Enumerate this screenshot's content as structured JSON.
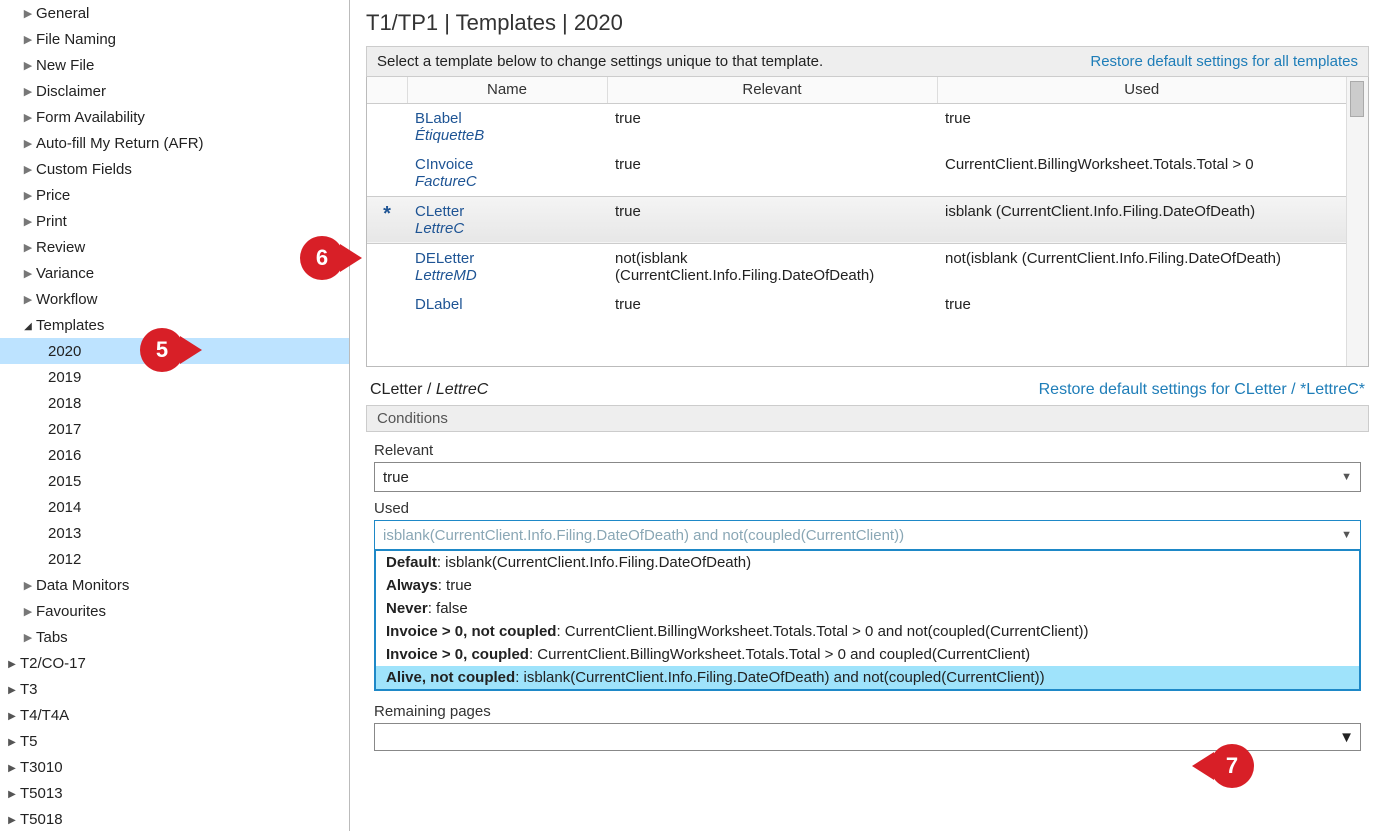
{
  "sidebar": {
    "items": [
      {
        "label": "General",
        "expandable": true
      },
      {
        "label": "File Naming",
        "expandable": true
      },
      {
        "label": "New File",
        "expandable": true
      },
      {
        "label": "Disclaimer",
        "expandable": true
      },
      {
        "label": "Form Availability",
        "expandable": true
      },
      {
        "label": "Auto-fill My Return (AFR)",
        "expandable": true
      },
      {
        "label": "Custom Fields",
        "expandable": true
      },
      {
        "label": "Price",
        "expandable": true
      },
      {
        "label": "Print",
        "expandable": true
      },
      {
        "label": "Review",
        "expandable": true
      },
      {
        "label": "Variance",
        "expandable": true
      },
      {
        "label": "Workflow",
        "expandable": true
      }
    ],
    "templates_label": "Templates",
    "years": [
      "2020",
      "2019",
      "2018",
      "2017",
      "2016",
      "2015",
      "2014",
      "2013",
      "2012"
    ],
    "selected_year": "2020",
    "items_after": [
      {
        "label": "Data Monitors",
        "expandable": true
      },
      {
        "label": "Favourites",
        "expandable": true
      },
      {
        "label": "Tabs",
        "expandable": true
      }
    ],
    "bottom": [
      "T2/CO-17",
      "T3",
      "T4/T4A",
      "T5",
      "T3010",
      "T5013",
      "T5018"
    ]
  },
  "breadcrumb": "T1/TP1 | Templates | 2020",
  "instruction": "Select a template below to change settings unique to that template.",
  "restore_all_link": "Restore default settings for all templates",
  "columns": {
    "name": "Name",
    "relevant": "Relevant",
    "used": "Used"
  },
  "rows": [
    {
      "flag": "",
      "name": "BLabel",
      "sub": "ÉtiquetteB",
      "relevant": "true",
      "used": "true"
    },
    {
      "flag": "",
      "name": "CInvoice",
      "sub": "FactureC",
      "relevant": "true",
      "used": "CurrentClient.BillingWorksheet.Totals.Total > 0"
    },
    {
      "flag": "*",
      "name": "CLetter",
      "sub": "LettreC",
      "relevant": "true",
      "used": "isblank (CurrentClient.Info.Filing.DateOfDeath)",
      "selected": true
    },
    {
      "flag": "",
      "name": "DELetter",
      "sub": "LettreMD",
      "relevant": "not(isblank (CurrentClient.Info.Filing.DateOfDeath)",
      "used": "not(isblank (CurrentClient.Info.Filing.DateOfDeath)"
    },
    {
      "flag": "",
      "name": "DLabel",
      "sub": "",
      "relevant": "true",
      "used": "true"
    }
  ],
  "detail_name": "CLetter / ",
  "detail_sub": "LettreC",
  "restore_one_link": "Restore default settings for CLetter / *LettreC*",
  "conditions_heading": "Conditions",
  "relevant_label": "Relevant",
  "relevant_value": "true",
  "used_label": "Used",
  "used_value": "isblank(CurrentClient.Info.Filing.DateOfDeath) and not(coupled(CurrentClient))",
  "dropdown": [
    {
      "bold": "Default",
      "rest": ": isblank(CurrentClient.Info.Filing.DateOfDeath)"
    },
    {
      "bold": "Always",
      "rest": ": true"
    },
    {
      "bold": "Never",
      "rest": ": false"
    },
    {
      "bold": "Invoice > 0, not coupled",
      "rest": ": CurrentClient.BillingWorksheet.Totals.Total > 0 and not(coupled(CurrentClient))"
    },
    {
      "bold": "Invoice > 0, coupled",
      "rest": ": CurrentClient.BillingWorksheet.Totals.Total > 0 and coupled(CurrentClient)"
    },
    {
      "bold": "Alive, not coupled",
      "rest": ": isblank(CurrentClient.Info.Filing.DateOfDeath) and not(coupled(CurrentClient))",
      "highlighted": true
    }
  ],
  "remaining_label": "Remaining pages",
  "callouts": {
    "5": "5",
    "6": "6",
    "7": "7"
  }
}
